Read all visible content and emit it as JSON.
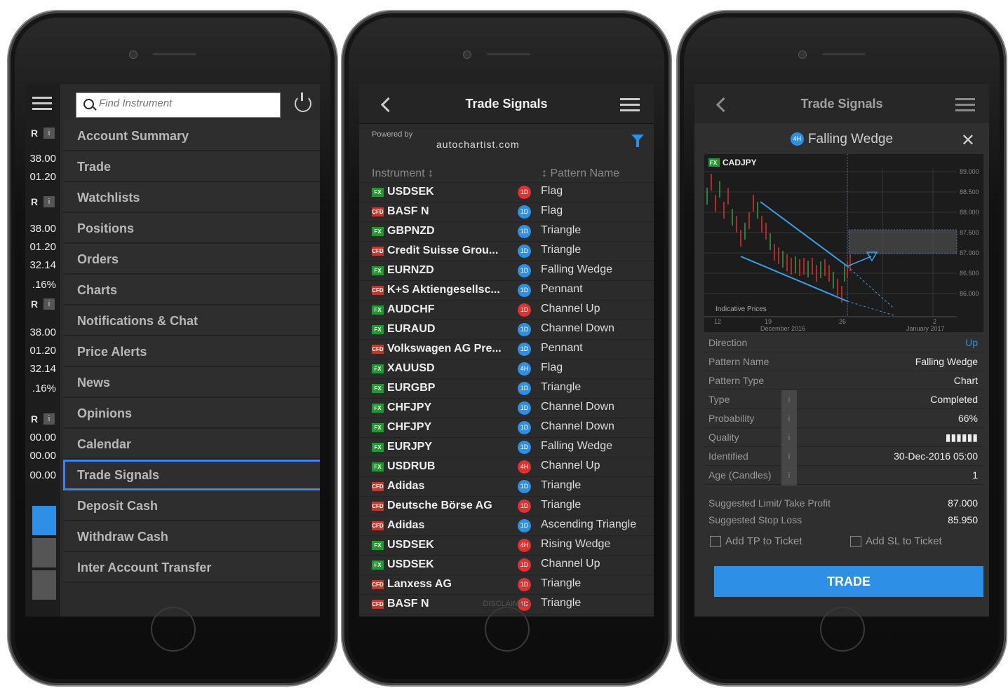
{
  "left_phone": {
    "search_placeholder": "Find Instrument",
    "menu": [
      "Account Summary",
      "Trade",
      "Watchlists",
      "Positions",
      "Orders",
      "Charts",
      "Notifications & Chat",
      "Price Alerts",
      "News",
      "Opinions",
      "Calendar",
      "Trade Signals",
      "Deposit Cash",
      "Withdraw Cash",
      "Inter Account Transfer"
    ],
    "active_item": "Trade Signals",
    "strip_values": [
      "38.00",
      "01.20",
      "38.00",
      "01.20",
      "32.14",
      ".16%",
      "38.00",
      "01.20",
      "32.14",
      ".16%",
      "00.00",
      "00.00",
      "00.00"
    ],
    "strip_labels": [
      "R",
      "i"
    ]
  },
  "middle_phone": {
    "title": "Trade Signals",
    "powered_by": "Powered by",
    "logo_text": "autochartist.com",
    "col_instrument": "Instrument ↕",
    "col_pattern": "↕ Pattern Name",
    "rows": [
      {
        "type": "FX",
        "inst": "USDSEK",
        "tf": "1D",
        "tfc": "r",
        "pattern": "Flag"
      },
      {
        "type": "CFD",
        "inst": "BASF N",
        "tf": "1D",
        "tfc": "b",
        "pattern": "Flag"
      },
      {
        "type": "FX",
        "inst": "GBPNZD",
        "tf": "1D",
        "tfc": "b",
        "pattern": "Triangle"
      },
      {
        "type": "CFD",
        "inst": "Credit Suisse Grou...",
        "tf": "1D",
        "tfc": "b",
        "pattern": "Triangle"
      },
      {
        "type": "FX",
        "inst": "EURNZD",
        "tf": "1D",
        "tfc": "b",
        "pattern": "Falling Wedge"
      },
      {
        "type": "CFD",
        "inst": "K+S Aktiengesellsc...",
        "tf": "1D",
        "tfc": "b",
        "pattern": "Pennant"
      },
      {
        "type": "FX",
        "inst": "AUDCHF",
        "tf": "1D",
        "tfc": "r",
        "pattern": "Channel Up"
      },
      {
        "type": "FX",
        "inst": "EURAUD",
        "tf": "1D",
        "tfc": "b",
        "pattern": "Channel Down"
      },
      {
        "type": "CFD",
        "inst": "Volkswagen AG Pre...",
        "tf": "1D",
        "tfc": "b",
        "pattern": "Pennant"
      },
      {
        "type": "FX",
        "inst": "XAUUSD",
        "tf": "4H",
        "tfc": "b",
        "pattern": "Flag"
      },
      {
        "type": "FX",
        "inst": "EURGBP",
        "tf": "1D",
        "tfc": "b",
        "pattern": "Triangle"
      },
      {
        "type": "FX",
        "inst": "CHFJPY",
        "tf": "1D",
        "tfc": "b",
        "pattern": "Channel Down"
      },
      {
        "type": "FX",
        "inst": "CHFJPY",
        "tf": "1D",
        "tfc": "b",
        "pattern": "Channel Down"
      },
      {
        "type": "FX",
        "inst": "EURJPY",
        "tf": "1D",
        "tfc": "b",
        "pattern": "Falling Wedge"
      },
      {
        "type": "FX",
        "inst": "USDRUB",
        "tf": "4H",
        "tfc": "r",
        "pattern": "Channel Up"
      },
      {
        "type": "CFD",
        "inst": "Adidas",
        "tf": "1D",
        "tfc": "b",
        "pattern": "Triangle"
      },
      {
        "type": "CFD",
        "inst": "Deutsche Börse AG",
        "tf": "1D",
        "tfc": "r",
        "pattern": "Triangle"
      },
      {
        "type": "CFD",
        "inst": "Adidas",
        "tf": "1D",
        "tfc": "b",
        "pattern": "Ascending Triangle"
      },
      {
        "type": "FX",
        "inst": "USDSEK",
        "tf": "4H",
        "tfc": "r",
        "pattern": "Rising Wedge"
      },
      {
        "type": "FX",
        "inst": "USDSEK",
        "tf": "1D",
        "tfc": "r",
        "pattern": "Channel Up"
      },
      {
        "type": "CFD",
        "inst": "Lanxess AG",
        "tf": "1D",
        "tfc": "r",
        "pattern": "Triangle"
      },
      {
        "type": "CFD",
        "inst": "BASF N",
        "tf": "1D",
        "tfc": "r",
        "pattern": "Triangle"
      }
    ],
    "disclaimer": "DISCLAIMER"
  },
  "right_phone": {
    "title": "Trade Signals",
    "panel_tf": "4H",
    "panel_title": "Falling Wedge",
    "chart_symbol": "CADJPY",
    "chart_badge": "FX",
    "chart_prices": [
      "89.000",
      "88.500",
      "88.000",
      "87.500",
      "87.000",
      "86.500",
      "86.000"
    ],
    "chart_dates": [
      "12",
      "19",
      "26",
      "2"
    ],
    "chart_months": [
      "December 2016",
      "January 2017"
    ],
    "chart_note": "Indicative Prices",
    "details": [
      {
        "k": "Direction",
        "v": "Up",
        "info": false,
        "blue": true
      },
      {
        "k": "Pattern Name",
        "v": "Falling Wedge",
        "info": false
      },
      {
        "k": "Pattern Type",
        "v": "Chart",
        "info": false
      },
      {
        "k": "Type",
        "v": "Completed",
        "info": true
      },
      {
        "k": "Probability",
        "v": "66%",
        "info": true
      },
      {
        "k": "Quality",
        "v": "▮▮▮▮▮▮",
        "info": true
      },
      {
        "k": "Identified",
        "v": "30-Dec-2016 05:00",
        "info": true
      },
      {
        "k": "Age (Candles)",
        "v": "1",
        "info": true
      }
    ],
    "suggested_limit_label": "Suggested Limit/ Take Profit",
    "suggested_limit": "87.000",
    "suggested_stop_label": "Suggested Stop Loss",
    "suggested_stop": "85.950",
    "add_tp": "Add TP to Ticket",
    "add_sl": "Add SL to Ticket",
    "trade_button": "TRADE",
    "info_glyph": "i"
  }
}
